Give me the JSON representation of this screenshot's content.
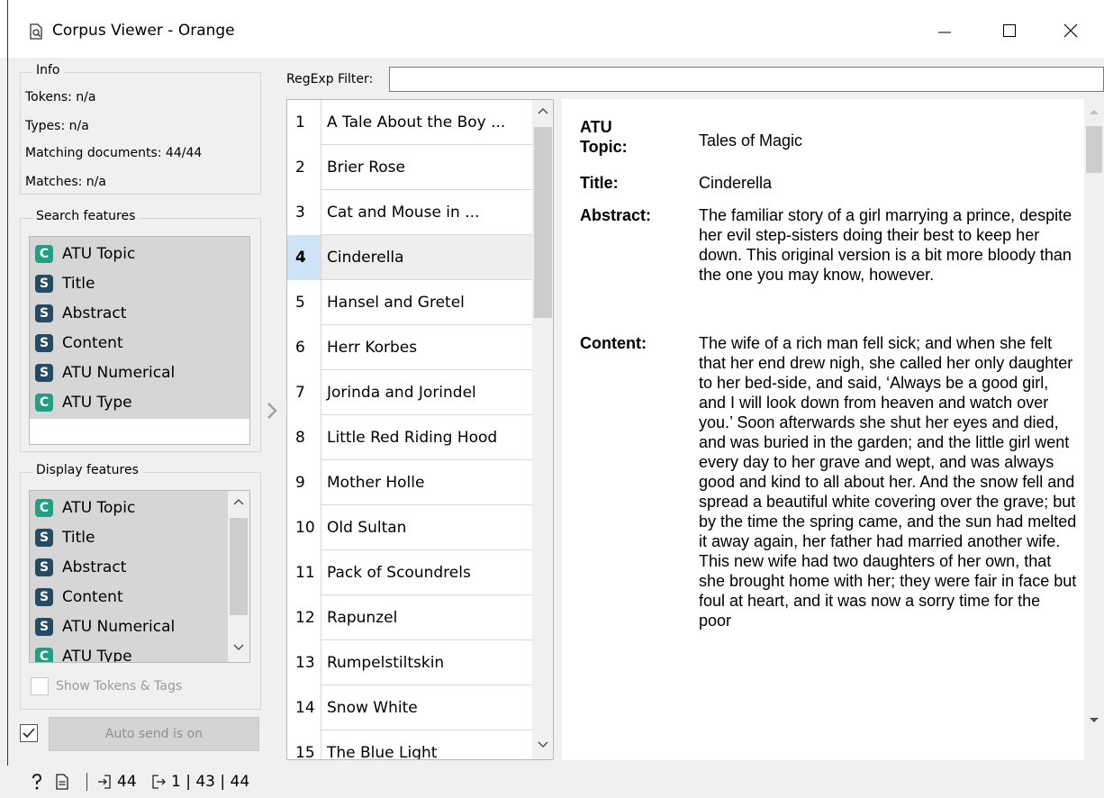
{
  "window": {
    "title": "Corpus Viewer - Orange",
    "minimize_icon": "minimize-icon",
    "maximize_icon": "maximize-icon",
    "close_icon": "close-icon"
  },
  "info": {
    "title": "Info",
    "tokens": "Tokens: n/a",
    "types": "Types: n/a",
    "matching": "Matching documents: 44/44",
    "matches": "Matches: n/a"
  },
  "search_features": {
    "title": "Search features",
    "items": [
      {
        "type": "C",
        "label": "ATU Topic"
      },
      {
        "type": "S",
        "label": "Title"
      },
      {
        "type": "S",
        "label": "Abstract"
      },
      {
        "type": "S",
        "label": "Content"
      },
      {
        "type": "S",
        "label": "ATU Numerical"
      },
      {
        "type": "C",
        "label": "ATU Type"
      }
    ]
  },
  "display_features": {
    "title": "Display features",
    "items": [
      {
        "type": "C",
        "label": "ATU Topic"
      },
      {
        "type": "S",
        "label": "Title"
      },
      {
        "type": "S",
        "label": "Abstract"
      },
      {
        "type": "S",
        "label": "Content"
      },
      {
        "type": "S",
        "label": "ATU Numerical"
      },
      {
        "type": "C",
        "label": "ATU Type"
      }
    ]
  },
  "show_tokens": {
    "label": "Show Tokens & Tags",
    "checked": false
  },
  "auto_send": {
    "label": "Auto send is on",
    "checked": true
  },
  "filter": {
    "label": "RegExp Filter:",
    "value": ""
  },
  "documents": [
    {
      "num": "1",
      "title": "A Tale About the Boy ..."
    },
    {
      "num": "2",
      "title": "Brier Rose"
    },
    {
      "num": "3",
      "title": "Cat and Mouse in ..."
    },
    {
      "num": "4",
      "title": "Cinderella"
    },
    {
      "num": "5",
      "title": "Hansel and Gretel"
    },
    {
      "num": "6",
      "title": "Herr Korbes"
    },
    {
      "num": "7",
      "title": "Jorinda and Jorindel"
    },
    {
      "num": "8",
      "title": "Little Red Riding Hood"
    },
    {
      "num": "9",
      "title": "Mother Holle"
    },
    {
      "num": "10",
      "title": "Old Sultan"
    },
    {
      "num": "11",
      "title": "Pack of Scoundrels"
    },
    {
      "num": "12",
      "title": "Rapunzel"
    },
    {
      "num": "13",
      "title": "Rumpelstiltskin"
    },
    {
      "num": "14",
      "title": "Snow White"
    },
    {
      "num": "15",
      "title": "The Blue Light"
    }
  ],
  "selected_document": "4",
  "viewer": {
    "topic_label_1": "ATU",
    "topic_label_2": "Topic:",
    "topic_value": "Tales of Magic",
    "title_label": "Title:",
    "title_value": "Cinderella",
    "abstract_label": "Abstract:",
    "abstract_value": "The familiar story of a girl marrying a prince, despite her evil step-sisters doing their best to keep her down. This original version is a bit more bloody than the one you may know, however.",
    "content_label": "Content:",
    "content_value": "The wife of a rich man fell sick; and when she felt that her end drew nigh, she called her only daughter to her bed-side, and said, ‘Always be a good girl, and I will look down from heaven and watch over you.’ Soon afterwards she shut her eyes and died, and was buried in the garden; and the little girl went every day to her grave and wept, and was always good and kind to all about her. And the snow fell and spread a beautiful white covering over the grave; but by the time the spring came, and the sun had melted it away again, her father had married another wife. This new wife had two daughters of her own, that she brought home with her; they were fair in face but foul at heart, and it was now a sorry time for the poor"
  },
  "status": {
    "help_icon": "help-icon",
    "report_icon": "report-icon",
    "input_count": "44",
    "output_counts": "1 | 43 | 44"
  },
  "colors": {
    "continuous_badge": "#20a080",
    "string_badge": "#254a63",
    "selection": "#cfe3f7"
  }
}
